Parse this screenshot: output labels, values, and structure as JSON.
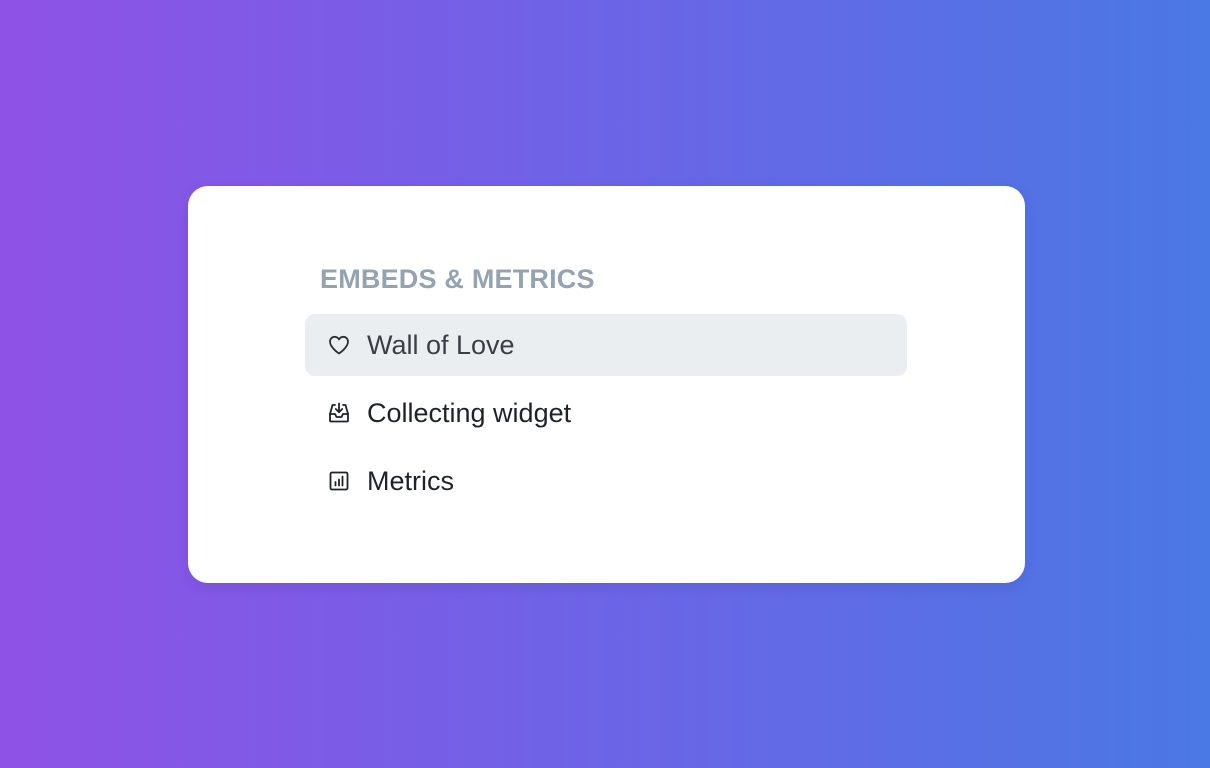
{
  "section": {
    "title": "EMBEDS & METRICS"
  },
  "menu": {
    "items": [
      {
        "label": "Wall of Love",
        "icon": "heart-icon",
        "active": true
      },
      {
        "label": "Collecting widget",
        "icon": "inbox-download-icon",
        "active": false
      },
      {
        "label": "Metrics",
        "icon": "bar-chart-icon",
        "active": false
      }
    ]
  },
  "colors": {
    "title": "#94a3b0",
    "active_background": "#eaeef1",
    "text": "#1f2328",
    "gradient_start": "#8f52e6",
    "gradient_end": "#4a78e4"
  }
}
